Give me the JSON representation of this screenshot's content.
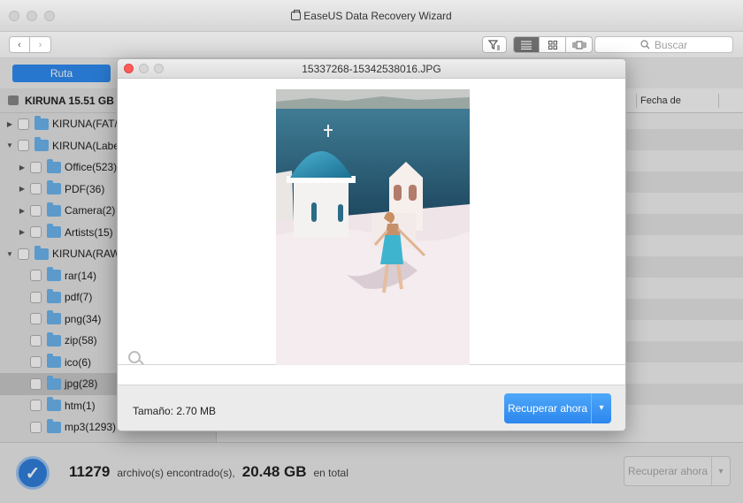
{
  "window": {
    "title": "EaseUS Data Recovery Wizard"
  },
  "toolbar": {
    "back_label": "‹",
    "forward_label": "›",
    "search_placeholder": "Buscar"
  },
  "tabs": {
    "ruta_label": "Ruta"
  },
  "sidebar": {
    "drive_label": "KIRUNA 15.51 GB",
    "items": [
      {
        "label": "KIRUNA(FAT/FA",
        "arrow": "▶"
      },
      {
        "label": "KIRUNA(Label I",
        "arrow": "▼"
      },
      {
        "label": "Office(523)",
        "arrow": "▶"
      },
      {
        "label": "PDF(36)",
        "arrow": "▶"
      },
      {
        "label": "Camera(2)",
        "arrow": "▶"
      },
      {
        "label": "Artists(15)",
        "arrow": "▶"
      },
      {
        "label": "KIRUNA(RAW F",
        "arrow": "▼"
      },
      {
        "label": "rar(14)",
        "arrow": ""
      },
      {
        "label": "pdf(7)",
        "arrow": ""
      },
      {
        "label": "png(34)",
        "arrow": ""
      },
      {
        "label": "zip(58)",
        "arrow": ""
      },
      {
        "label": "ico(6)",
        "arrow": ""
      },
      {
        "label": "jpg(28)",
        "arrow": ""
      },
      {
        "label": "htm(1)",
        "arrow": ""
      },
      {
        "label": "mp3(1293)",
        "arrow": ""
      }
    ]
  },
  "list": {
    "col_date": "Fecha de"
  },
  "status": {
    "file_count": "11279",
    "files_found_text": "archivo(s) encontrado(s),",
    "total_size": "20.48 GB",
    "total_text": "en total",
    "recover_label": "Recuperar ahora"
  },
  "preview": {
    "filename": "15337268-15342538016.JPG",
    "size_text": "Tamaño: 2.70 MB",
    "recover_label": "Recuperar ahora"
  },
  "colors": {
    "accent_blue": "#2f8cf2",
    "close_red": "#fc5b57"
  }
}
